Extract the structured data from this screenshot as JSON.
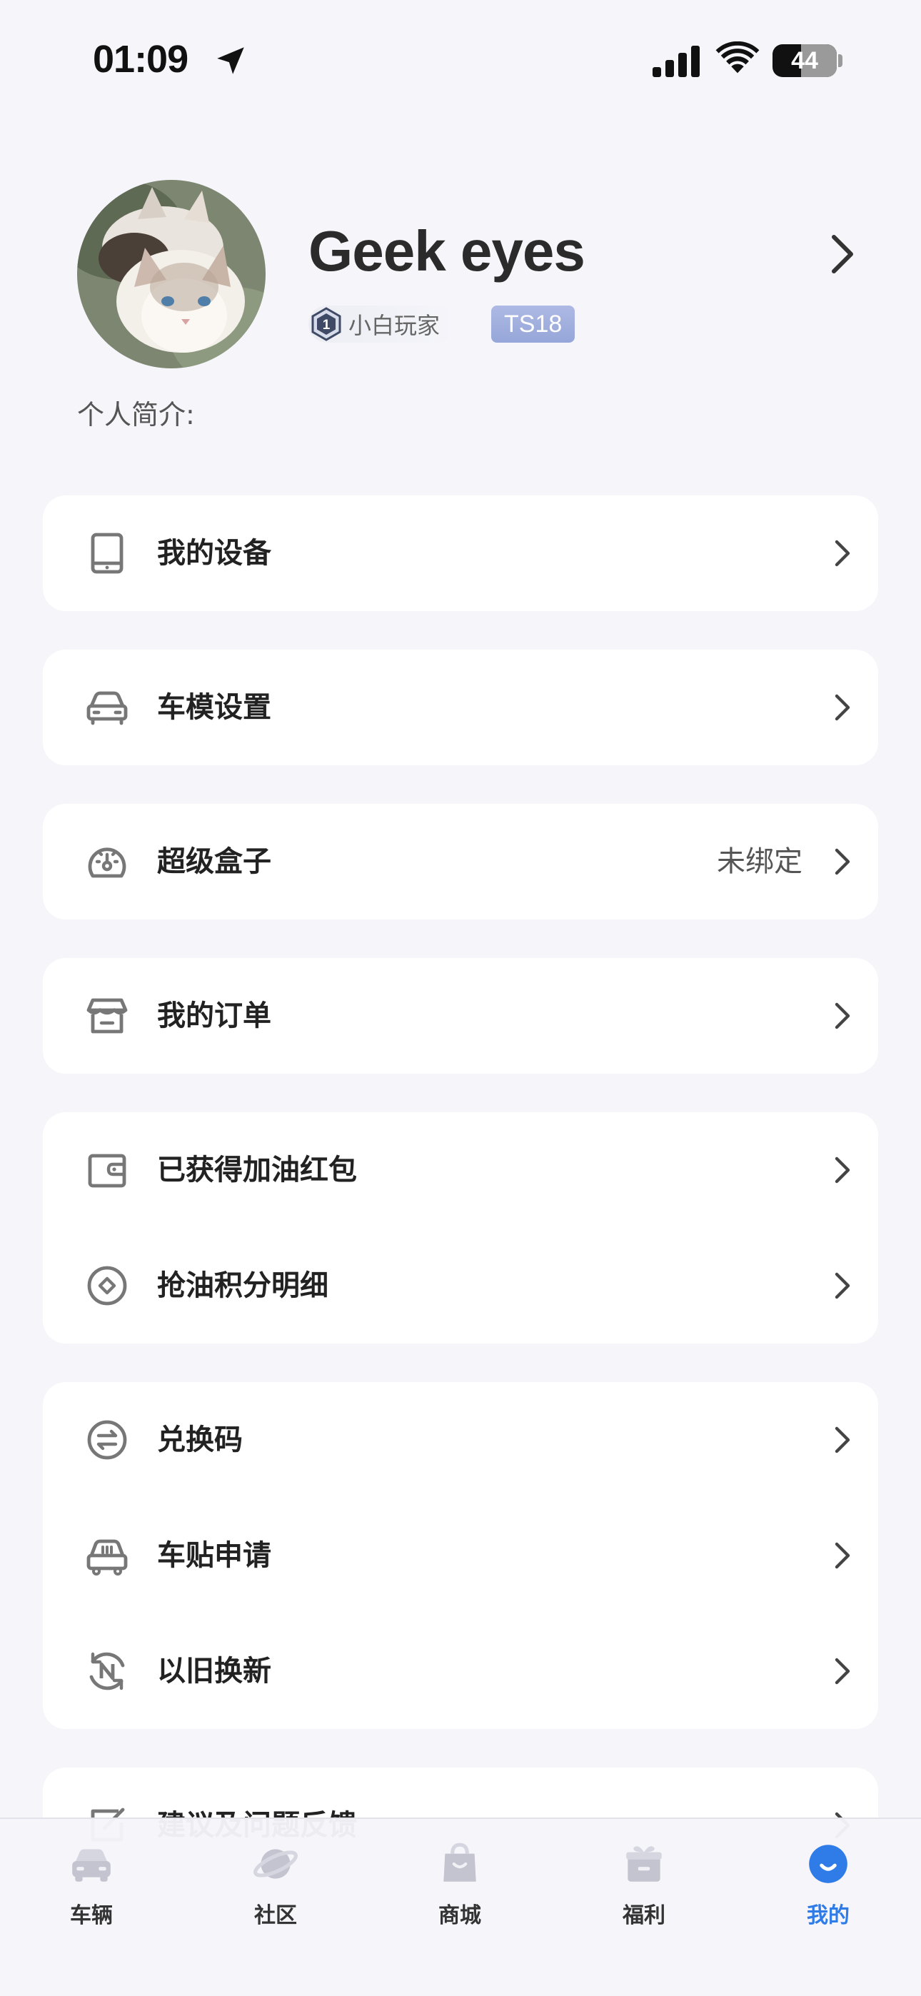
{
  "status_bar": {
    "time": "01:09",
    "battery": "44",
    "battery_level": 0.44
  },
  "profile": {
    "username": "Geek eyes",
    "level_number": "1",
    "level_name": "小白玩家",
    "model_tag": "TS18",
    "bio_label": "个人简介:"
  },
  "menu": {
    "my_devices": "我的设备",
    "car_model_settings": "车模设置",
    "super_box": "超级盒子",
    "super_box_status": "未绑定",
    "my_orders": "我的订单",
    "fuel_red_packets": "已获得加油红包",
    "fuel_points_details": "抢油积分明细",
    "redeem_code": "兑换码",
    "car_sticker_application": "车贴申请",
    "trade_in": "以旧换新",
    "feedback": "建议及问题反馈"
  },
  "tabbar": {
    "vehicle": "车辆",
    "community": "社区",
    "mall": "商城",
    "benefits": "福利",
    "mine": "我的"
  },
  "colors": {
    "accent": "#2f7be8",
    "background": "#f5f5fa",
    "tag": "#9aa9da"
  }
}
